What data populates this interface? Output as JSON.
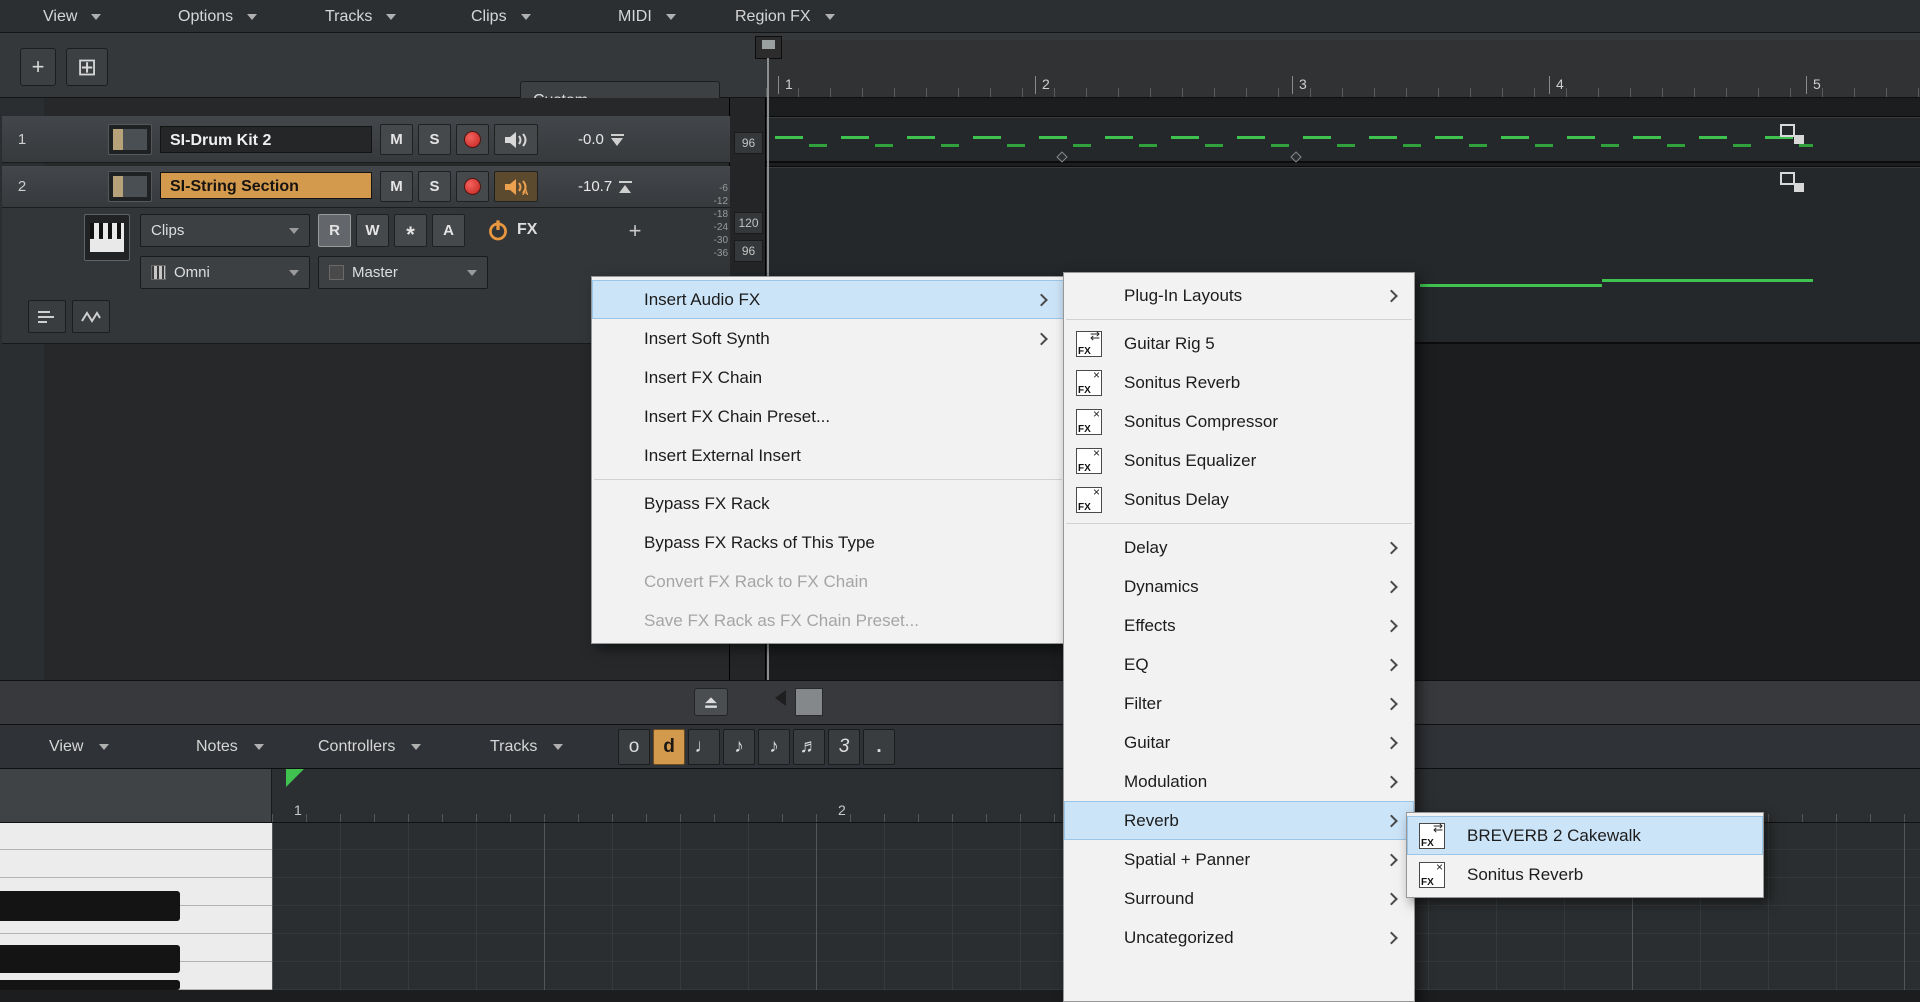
{
  "colors": {
    "accent_orange": "#d39a4d",
    "midi_green": "#3fc24f",
    "record_red": "#d8332d",
    "menu_highlight": "#cce4f7"
  },
  "menubar": {
    "items": [
      {
        "label": "View"
      },
      {
        "label": "Options"
      },
      {
        "label": "Tracks"
      },
      {
        "label": "Clips"
      },
      {
        "label": "MIDI"
      },
      {
        "label": "Region FX"
      }
    ]
  },
  "toolbar": {
    "add": "+",
    "duplicate": "⊞",
    "preset": "Custom"
  },
  "ruler": {
    "marks": [
      "1",
      "2",
      "3",
      "4",
      "5"
    ]
  },
  "track_panel": {
    "track1": {
      "num": "1",
      "name": "SI-Drum Kit 2",
      "mute": "M",
      "solo": "S",
      "gain": "-0.0"
    },
    "track2": {
      "num": "2",
      "name": "SI-String Section",
      "mute": "M",
      "solo": "S",
      "gain": "-10.7"
    },
    "controls": {
      "clips": "Clips",
      "read": "R",
      "write": "W",
      "star": "*",
      "audition": "A",
      "fx": "FX",
      "add_fx": "+",
      "input": "Omni",
      "output": "Master"
    }
  },
  "meter": {
    "val_top": "96",
    "val_mid": "120",
    "val_bot": "96",
    "db_scale": [
      "-6",
      "-12",
      "-18",
      "-24",
      "-30",
      "-36"
    ]
  },
  "context_menu": {
    "items": [
      {
        "label": "Insert Audio FX"
      },
      {
        "label": "Insert Soft Synth"
      },
      {
        "label": "Insert FX Chain"
      },
      {
        "label": "Insert FX Chain Preset..."
      },
      {
        "label": "Insert External Insert"
      },
      {
        "label": "Bypass FX Rack"
      },
      {
        "label": "Bypass FX Racks of This Type"
      },
      {
        "label": "Convert FX Rack to FX Chain"
      },
      {
        "label": "Save FX Rack as FX Chain Preset..."
      }
    ]
  },
  "fx_menu": {
    "items": [
      {
        "label": "Plug-In Layouts"
      },
      {
        "label": "Guitar Rig 5"
      },
      {
        "label": "Sonitus Reverb"
      },
      {
        "label": "Sonitus Compressor"
      },
      {
        "label": "Sonitus Equalizer"
      },
      {
        "label": "Sonitus Delay"
      },
      {
        "label": "Delay"
      },
      {
        "label": "Dynamics"
      },
      {
        "label": "Effects"
      },
      {
        "label": "EQ"
      },
      {
        "label": "Filter"
      },
      {
        "label": "Guitar"
      },
      {
        "label": "Modulation"
      },
      {
        "label": "Reverb"
      },
      {
        "label": "Spatial + Panner"
      },
      {
        "label": "Surround"
      },
      {
        "label": "Uncategorized"
      }
    ]
  },
  "reverb_menu": {
    "items": [
      {
        "label": "BREVERB 2 Cakewalk"
      },
      {
        "label": "Sonitus Reverb"
      }
    ]
  },
  "fx_icon": {
    "label": "FX",
    "io_glyph": "⇄",
    "x_glyph": "×"
  },
  "bottom_panel": {
    "menus": [
      {
        "label": "View"
      },
      {
        "label": "Notes"
      },
      {
        "label": "Controllers"
      },
      {
        "label": "Tracks"
      }
    ],
    "note_buttons": [
      {
        "glyph": "o"
      },
      {
        "glyph": "d"
      },
      {
        "glyph": "♩"
      },
      {
        "glyph": "♪"
      },
      {
        "glyph": "♪"
      },
      {
        "glyph": "♬"
      },
      {
        "glyph": "3"
      },
      {
        "glyph": "."
      }
    ],
    "ruler_marks": [
      "1",
      "2"
    ]
  }
}
